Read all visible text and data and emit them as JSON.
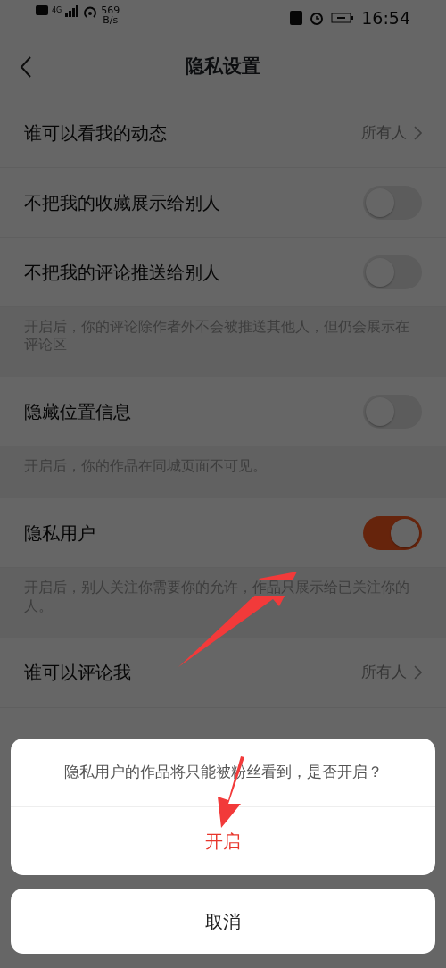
{
  "status_bar": {
    "network": "4G",
    "speed": "569",
    "speed_unit": "B/s",
    "time": "16:54"
  },
  "header": {
    "title": "隐私设置"
  },
  "settings": [
    {
      "kind": "link",
      "label": "谁可以看我的动态",
      "value": "所有人"
    },
    {
      "kind": "toggle",
      "label": "不把我的收藏展示给别人",
      "on": false
    },
    {
      "kind": "toggle",
      "label": "不把我的评论推送给别人",
      "on": false
    },
    {
      "kind": "note",
      "text": "开启后，你的评论除作者外不会被推送其他人，但仍会展示在评论区"
    },
    {
      "kind": "toggle",
      "label": "隐藏位置信息",
      "on": false
    },
    {
      "kind": "note",
      "text": "开启后，你的作品在同城页面不可见。"
    },
    {
      "kind": "toggle",
      "label": "隐私用户",
      "on": true
    },
    {
      "kind": "note",
      "text": "开启后，别人关注你需要你的允许，作品只展示给已关注你的人。"
    },
    {
      "kind": "link",
      "label": "谁可以评论我",
      "value": "所有人"
    }
  ],
  "dialog": {
    "message": "隐私用户的作品将只能被粉丝看到，是否开启？",
    "confirm": "开启",
    "cancel": "取消"
  }
}
